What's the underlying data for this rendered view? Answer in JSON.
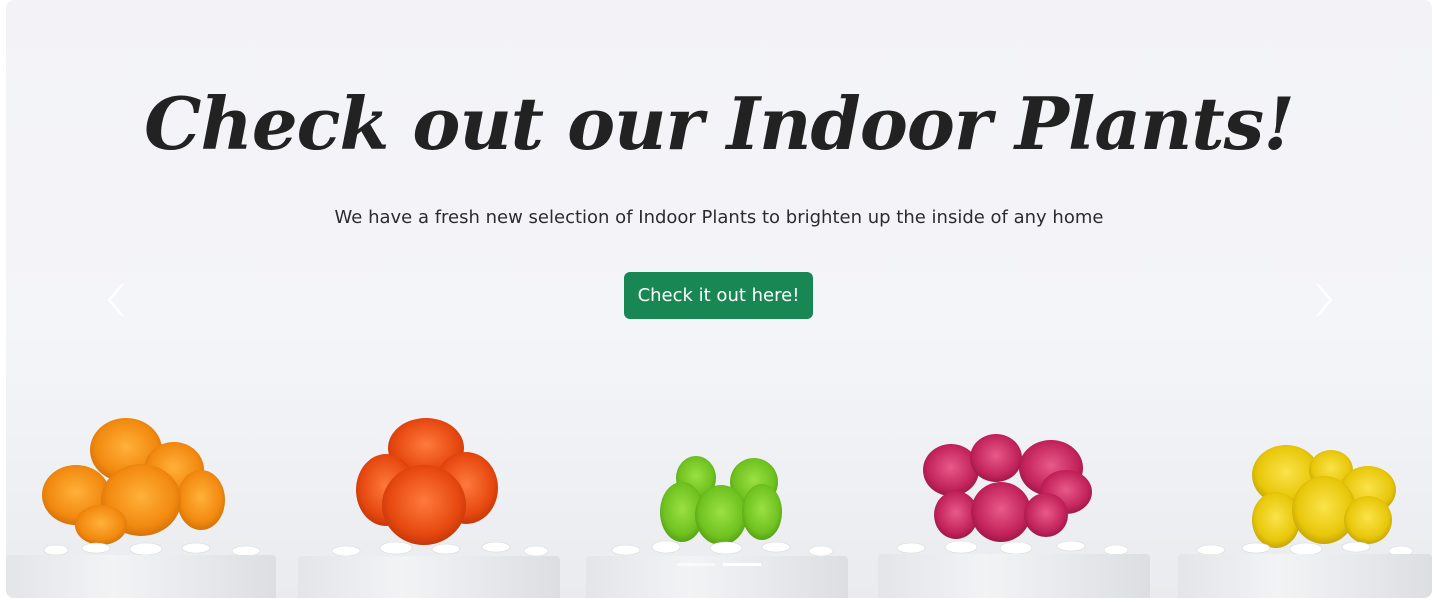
{
  "carousel": {
    "headline": "Check out our Indoor Plants!",
    "subtext": "We have a fresh new selection of Indoor Plants to brighten up the inside of any home",
    "cta_label": "Check it out here!",
    "active_slide": 2,
    "slide_count": 2
  },
  "colors": {
    "cta": "#198754",
    "cactus_orange": "#f2890f",
    "cactus_red": "#e6480f",
    "cactus_green": "#6fc21f",
    "cactus_pink": "#c2235a",
    "cactus_yellow": "#e8c70a"
  },
  "icons": {
    "prev": "chevron-left-icon",
    "next": "chevron-right-icon"
  }
}
